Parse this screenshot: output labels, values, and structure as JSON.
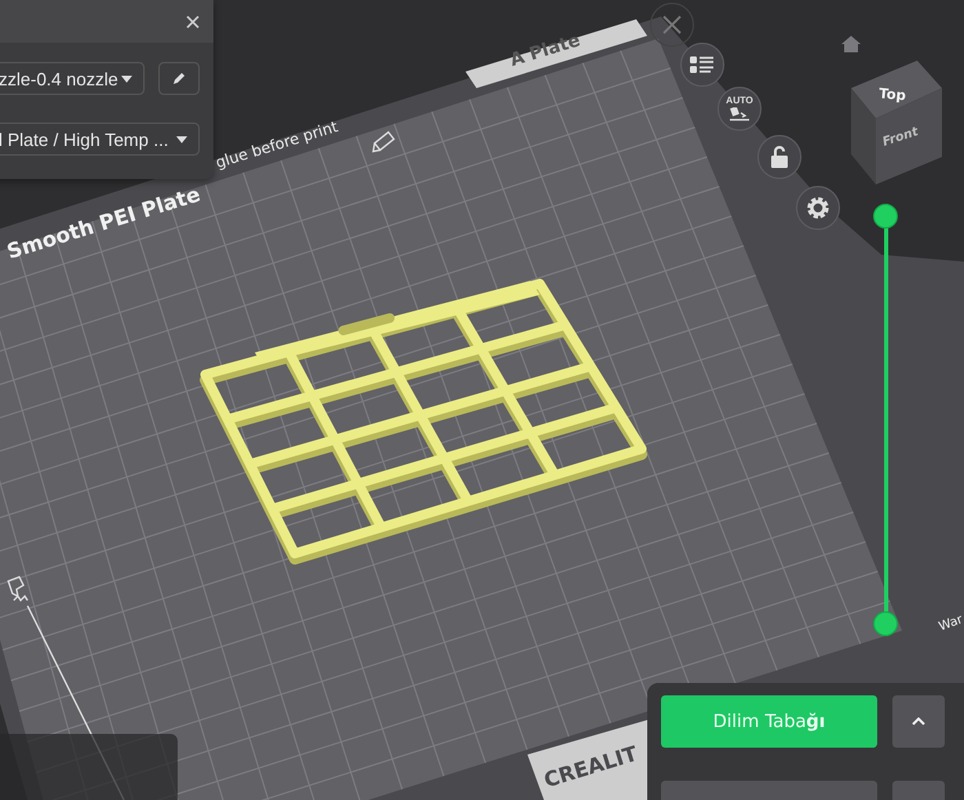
{
  "printer_panel": {
    "printer": "zzle-0.4 nozzle",
    "plate_type": "l Plate / High Temp ..."
  },
  "plate": {
    "name_tab": "A Plate",
    "label": "Smooth PEI Plate",
    "notice": "glue before print",
    "brand": "CREALIT",
    "corner_text": "War"
  },
  "toolbar": [
    {
      "kind": "close",
      "disabled": true
    },
    {
      "kind": "list",
      "disabled": false
    },
    {
      "kind": "auto",
      "label": "AUTO",
      "disabled": false
    },
    {
      "kind": "lock",
      "disabled": false
    },
    {
      "kind": "settings",
      "disabled": false
    }
  ],
  "layer_slider": {
    "handles": [
      {
        "level": 1
      },
      {
        "level": 0
      }
    ]
  },
  "view_cube": {
    "top": "Top",
    "front": "Front"
  },
  "slice_button": {
    "label": "Dilim Taba**ğı**"
  }
}
